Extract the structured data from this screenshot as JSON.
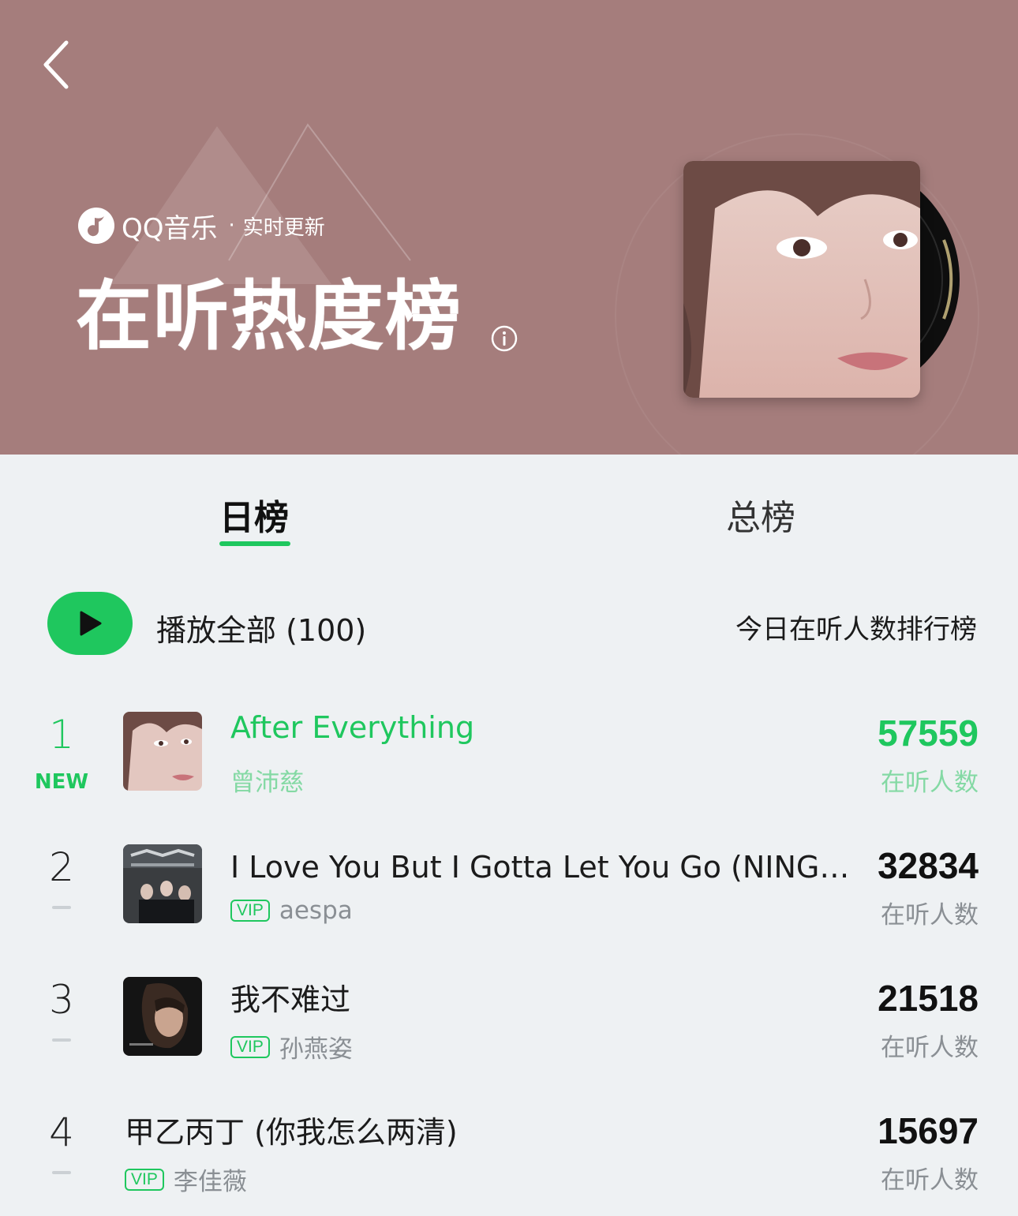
{
  "header": {
    "brand_name": "QQ音乐",
    "brand_separator": "·",
    "brand_subtitle": "实时更新",
    "chart_title": "在听热度榜",
    "background_color": "#a57d7c"
  },
  "tabs": [
    {
      "label": "日榜",
      "active": true
    },
    {
      "label": "总榜",
      "active": false
    }
  ],
  "play_all": {
    "label": "播放全部 (100)"
  },
  "chart_description": "今日在听人数排行榜",
  "accent_color": "#1fc75e",
  "songs": [
    {
      "rank": "1",
      "badge": "NEW",
      "title": "After Everything",
      "vip": "",
      "artist": "曾沛慈",
      "count": "57559",
      "count_label": "在听人数"
    },
    {
      "rank": "2",
      "badge": "",
      "title": "I Love You But I Gotta Let You Go (NINGNING (宁艺卓) Solo)",
      "vip": "VIP",
      "artist": "aespa",
      "count": "32834",
      "count_label": "在听人数"
    },
    {
      "rank": "3",
      "badge": "",
      "title": "我不难过",
      "vip": "VIP",
      "artist": "孙燕姿",
      "count": "21518",
      "count_label": "在听人数"
    },
    {
      "rank": "4",
      "badge": "",
      "title": "甲乙丙丁 (你我怎么两清)",
      "vip": "VIP",
      "artist": "李佳薇",
      "count": "15697",
      "count_label": "在听人数"
    }
  ]
}
